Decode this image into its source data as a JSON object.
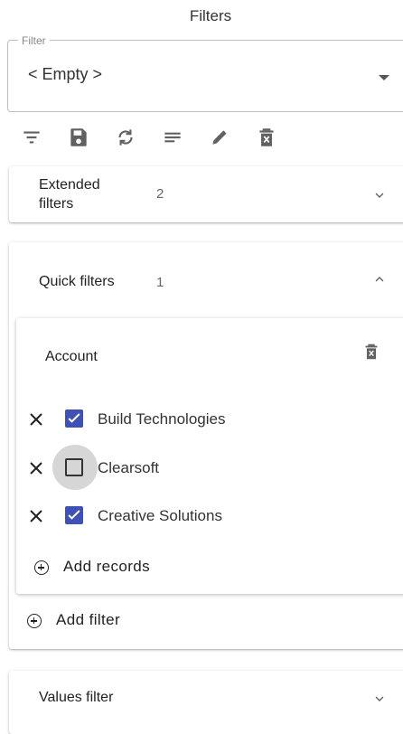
{
  "header": {
    "title": "Filters"
  },
  "filter_select": {
    "legend": "Filter",
    "value": "< Empty >"
  },
  "toolbar": {
    "icons": [
      "filter-list-icon",
      "save-icon",
      "refresh-icon",
      "notes-icon",
      "edit-icon",
      "delete-icon"
    ]
  },
  "extended_filters": {
    "title_line1": "Extended",
    "title_line2": "filters",
    "count": "2"
  },
  "quick_filters": {
    "title": "Quick filters",
    "count": "1",
    "account_card": {
      "title": "Account",
      "items": [
        {
          "label": "Build Technologies",
          "checked": true
        },
        {
          "label": "Clearsoft",
          "checked": false
        },
        {
          "label": "Creative Solutions",
          "checked": true
        }
      ],
      "add_records_label": "Add records"
    },
    "add_filter_label": "Add filter"
  },
  "values_filter": {
    "title": "Values filter"
  },
  "colors": {
    "accent": "#3f51b5",
    "icon": "#616161"
  }
}
